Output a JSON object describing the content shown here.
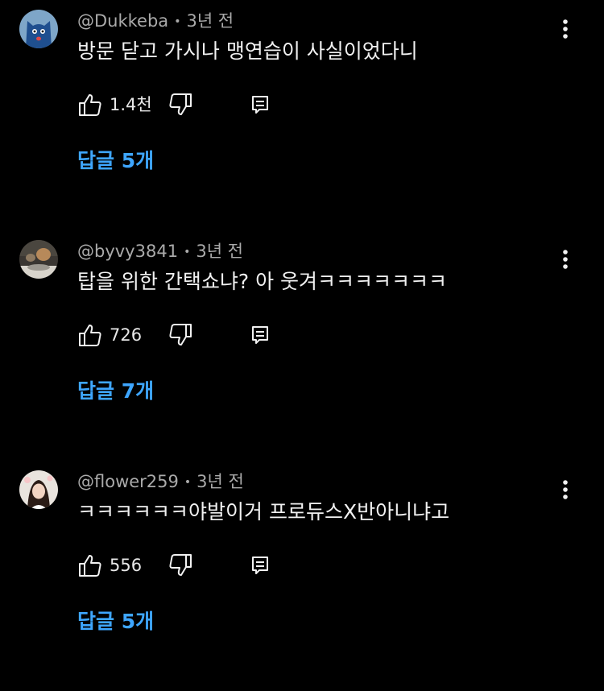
{
  "comments": [
    {
      "handle": "@Dukkeba",
      "time": "3년 전",
      "text": "방문 닫고 가시나 맹연습이 사실이었다니",
      "likes": "1.4천",
      "replies_label": "답글 5개",
      "avatar": "blue-cartoon-cat-avatar"
    },
    {
      "handle": "@byvy3841",
      "time": "3년 전",
      "text": "탑을 위한 간택쇼냐? 아 웃겨ㅋㅋㅋㅋㅋㅋㅋ",
      "likes": "726",
      "replies_label": "답글 7개",
      "avatar": "photo-avatar"
    },
    {
      "handle": "@flower259",
      "time": "3년 전",
      "text": "ㅋㅋㅋㅋㅋㅋ야발이거 프로듀스X반아니냐고",
      "likes": "556",
      "replies_label": "답글 5개",
      "avatar": "photo-avatar-person"
    }
  ],
  "icons": {
    "like": "thumbs-up-icon",
    "dislike": "thumbs-down-icon",
    "reply": "reply-comment-icon",
    "more": "more-vertical-icon"
  },
  "colors": {
    "background": "#000000",
    "text": "#f1f1f1",
    "secondary": "#aaaaaa",
    "link": "#3ea6ff"
  }
}
